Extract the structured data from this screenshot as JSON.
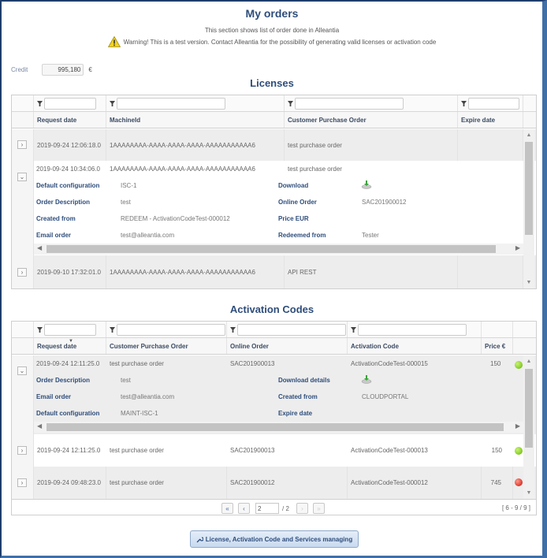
{
  "header": {
    "title": "My orders",
    "subtitle": "This section shows list of order done in Alleantia",
    "warning": "Warning! This is a test version. Contact Alleantia for the possibility of generating valid licenses or activation code"
  },
  "credit": {
    "label": "Credit",
    "value": "995,180",
    "unit": "€"
  },
  "licenses": {
    "title": "Licenses",
    "columns": [
      "Request date",
      "MachineId",
      "Customer Purchase Order",
      "Expire date"
    ],
    "rows": [
      {
        "request_date": "2019-09-24 12:06:18.0",
        "machine_id": "1AAAAAAAA-AAAA-AAAA-AAAA-AAAAAAAAAAA6",
        "customer_po": "test purchase order",
        "expire_date": "",
        "expanded": false
      },
      {
        "request_date": "2019-09-24 10:34:06.0",
        "machine_id": "1AAAAAAAA-AAAA-AAAA-AAAA-AAAAAAAAAAA6",
        "customer_po": "test purchase order",
        "expire_date": "",
        "expanded": true
      },
      {
        "request_date": "2019-09-10 17:32:01.0",
        "machine_id": "1AAAAAAAA-AAAA-AAAA-AAAA-AAAAAAAAAAA6",
        "customer_po": "API REST",
        "expire_date": "",
        "expanded": false
      }
    ],
    "details": {
      "left": [
        {
          "label": "Default configuration",
          "value": "ISC-1"
        },
        {
          "label": "Order Description",
          "value": "test"
        },
        {
          "label": "Created from",
          "value": "REDEEM - ActivationCodeTest-000012"
        },
        {
          "label": "Email order",
          "value": "test@alleantia.com"
        }
      ],
      "right": [
        {
          "label": "Download",
          "value": "",
          "icon": "download-icon"
        },
        {
          "label": "Online Order",
          "value": "SAC201900012"
        },
        {
          "label": "Price EUR",
          "value": ""
        },
        {
          "label": "Redeemed from",
          "value": "Tester"
        }
      ]
    }
  },
  "activation_codes": {
    "title": "Activation Codes",
    "columns": [
      "Request date",
      "Customer Purchase Order",
      "Online Order",
      "Activation Code",
      "Price €"
    ],
    "rows": [
      {
        "request_date": "2019-09-24 12:11:25.0",
        "customer_po": "test purchase order",
        "online_order": "SAC201900013",
        "activation_code": "ActivationCodeTest-000015",
        "price": "150",
        "status": "green",
        "expanded": true
      },
      {
        "request_date": "2019-09-24 12:11:25.0",
        "customer_po": "test purchase order",
        "online_order": "SAC201900013",
        "activation_code": "ActivationCodeTest-000013",
        "price": "150",
        "status": "green",
        "expanded": false
      },
      {
        "request_date": "2019-09-24 09:48:23.0",
        "customer_po": "test purchase order",
        "online_order": "SAC201900012",
        "activation_code": "ActivationCodeTest-000012",
        "price": "745",
        "status": "red",
        "expanded": false
      }
    ],
    "details": {
      "left": [
        {
          "label": "Order Description",
          "value": "test"
        },
        {
          "label": "Email order",
          "value": "test@alleantia.com"
        },
        {
          "label": "Default configuration",
          "value": "MAINT-ISC-1"
        }
      ],
      "right": [
        {
          "label": "Download details",
          "value": "",
          "icon": "download-icon"
        },
        {
          "label": "Created from",
          "value": "CLOUDPORTAL"
        },
        {
          "label": "Expire date",
          "value": ""
        }
      ]
    },
    "pager": {
      "current_page": "2",
      "total_pages": "/ 2",
      "range": "[ 6 - 9 / 9 ]"
    }
  },
  "colors": {
    "accent": "#2e4d7b",
    "status_green": "#8cd12a",
    "status_red": "#e0443a"
  },
  "footer": {
    "manage_button": "License, Activation Code and Services managing"
  }
}
